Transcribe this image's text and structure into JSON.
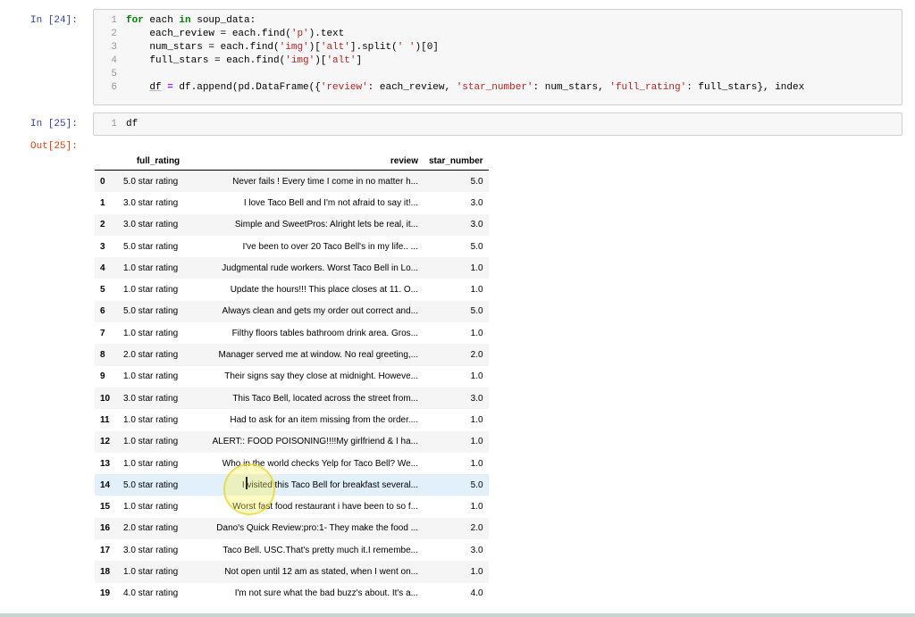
{
  "cells": [
    {
      "prompt": "In [24]:",
      "lines": [
        {
          "n": "1",
          "segments": [
            [
              "kw",
              "for"
            ],
            [
              "txt",
              " each "
            ],
            [
              "kw",
              "in"
            ],
            [
              "txt",
              " soup_data:"
            ]
          ]
        },
        {
          "n": "2",
          "segments": [
            [
              "txt",
              "    each_review = each.find("
            ],
            [
              "str",
              "'p'"
            ],
            [
              "txt",
              ").text"
            ]
          ]
        },
        {
          "n": "3",
          "segments": [
            [
              "txt",
              "    num_stars = each.find("
            ],
            [
              "str",
              "'img'"
            ],
            [
              "txt",
              ")["
            ],
            [
              "str",
              "'alt'"
            ],
            [
              "txt",
              "].split("
            ],
            [
              "str",
              "' '"
            ],
            [
              "txt",
              ")[0]"
            ]
          ]
        },
        {
          "n": "4",
          "segments": [
            [
              "txt",
              "    full_stars = each.find("
            ],
            [
              "str",
              "'img'"
            ],
            [
              "txt",
              ")["
            ],
            [
              "str",
              "'alt'"
            ],
            [
              "txt",
              "]"
            ]
          ]
        },
        {
          "n": "5",
          "segments": []
        },
        {
          "n": "6",
          "segments": [
            [
              "txt",
              "    "
            ],
            [
              "hl",
              "df"
            ],
            [
              "txt",
              " "
            ],
            [
              "op",
              "="
            ],
            [
              "txt",
              " df.append(pd.DataFrame({"
            ],
            [
              "str",
              "'review'"
            ],
            [
              "txt",
              ": each_review, "
            ],
            [
              "str",
              "'star_number'"
            ],
            [
              "txt",
              ": num_stars, "
            ],
            [
              "str",
              "'full_rating'"
            ],
            [
              "txt",
              ": full_stars}, index"
            ]
          ]
        }
      ]
    },
    {
      "prompt": "In [25]:",
      "lines": [
        {
          "n": "1",
          "segments": [
            [
              "txt",
              "df"
            ]
          ]
        }
      ]
    }
  ],
  "output_prompt": "Out[25]:",
  "table": {
    "headers": {
      "full_rating": "full_rating",
      "review": "review",
      "star_number": "star_number"
    },
    "rows": [
      {
        "idx": "0",
        "full_rating": "5.0 star rating",
        "review": "Never fails ! Every time I come in no matter h...",
        "star_number": "5.0"
      },
      {
        "idx": "1",
        "full_rating": "3.0 star rating",
        "review": "I love Taco Bell and I'm not afraid to say it!...",
        "star_number": "3.0"
      },
      {
        "idx": "2",
        "full_rating": "3.0 star rating",
        "review": "Simple and SweetPros: Alright lets be real, it...",
        "star_number": "3.0"
      },
      {
        "idx": "3",
        "full_rating": "5.0 star rating",
        "review": "I've been to over 20 Taco Bell's in my life.. ...",
        "star_number": "5.0"
      },
      {
        "idx": "4",
        "full_rating": "1.0 star rating",
        "review": "Judgmental rude workers. Worst Taco Bell in Lo...",
        "star_number": "1.0"
      },
      {
        "idx": "5",
        "full_rating": "1.0 star rating",
        "review": "Update the hours!!! This place closes at 11. O...",
        "star_number": "1.0"
      },
      {
        "idx": "6",
        "full_rating": "5.0 star rating",
        "review": "Always clean and gets my order out correct and...",
        "star_number": "5.0"
      },
      {
        "idx": "7",
        "full_rating": "1.0 star rating",
        "review": "Filthy floors tables bathroom drink area. Gros...",
        "star_number": "1.0"
      },
      {
        "idx": "8",
        "full_rating": "2.0 star rating",
        "review": "Manager served me at window. No real greeting,...",
        "star_number": "2.0"
      },
      {
        "idx": "9",
        "full_rating": "1.0 star rating",
        "review": "Their signs say they close at midnight. Howeve...",
        "star_number": "1.0"
      },
      {
        "idx": "10",
        "full_rating": "3.0 star rating",
        "review": "This Taco Bell, located across the street from...",
        "star_number": "3.0"
      },
      {
        "idx": "11",
        "full_rating": "1.0 star rating",
        "review": "Had to ask for an item missing from the order....",
        "star_number": "1.0"
      },
      {
        "idx": "12",
        "full_rating": "1.0 star rating",
        "review": "ALERT:: FOOD POISONING!!!!My girlfriend & I ha...",
        "star_number": "1.0"
      },
      {
        "idx": "13",
        "full_rating": "1.0 star rating",
        "review": "Who in the world checks Yelp for Taco Bell? We...",
        "star_number": "1.0"
      },
      {
        "idx": "14",
        "full_rating": "5.0 star rating",
        "review": "I visited this Taco Bell for breakfast several...",
        "star_number": "5.0"
      },
      {
        "idx": "15",
        "full_rating": "1.0 star rating",
        "review": "Worst fast food restaurant i have been to so f...",
        "star_number": "1.0"
      },
      {
        "idx": "16",
        "full_rating": "2.0 star rating",
        "review": "Dano's Quick Review:pro:1- They make the food ...",
        "star_number": "2.0"
      },
      {
        "idx": "17",
        "full_rating": "3.0 star rating",
        "review": "Taco Bell. USC.That's pretty much it.I remembe...",
        "star_number": "3.0"
      },
      {
        "idx": "18",
        "full_rating": "1.0 star rating",
        "review": "Not open until 12 am as stated, when I went on...",
        "star_number": "1.0"
      },
      {
        "idx": "19",
        "full_rating": "4.0 star rating",
        "review": "I'm not sure what the bad buzz's about. It's a...",
        "star_number": "4.0"
      }
    ],
    "hover_row": "14"
  }
}
